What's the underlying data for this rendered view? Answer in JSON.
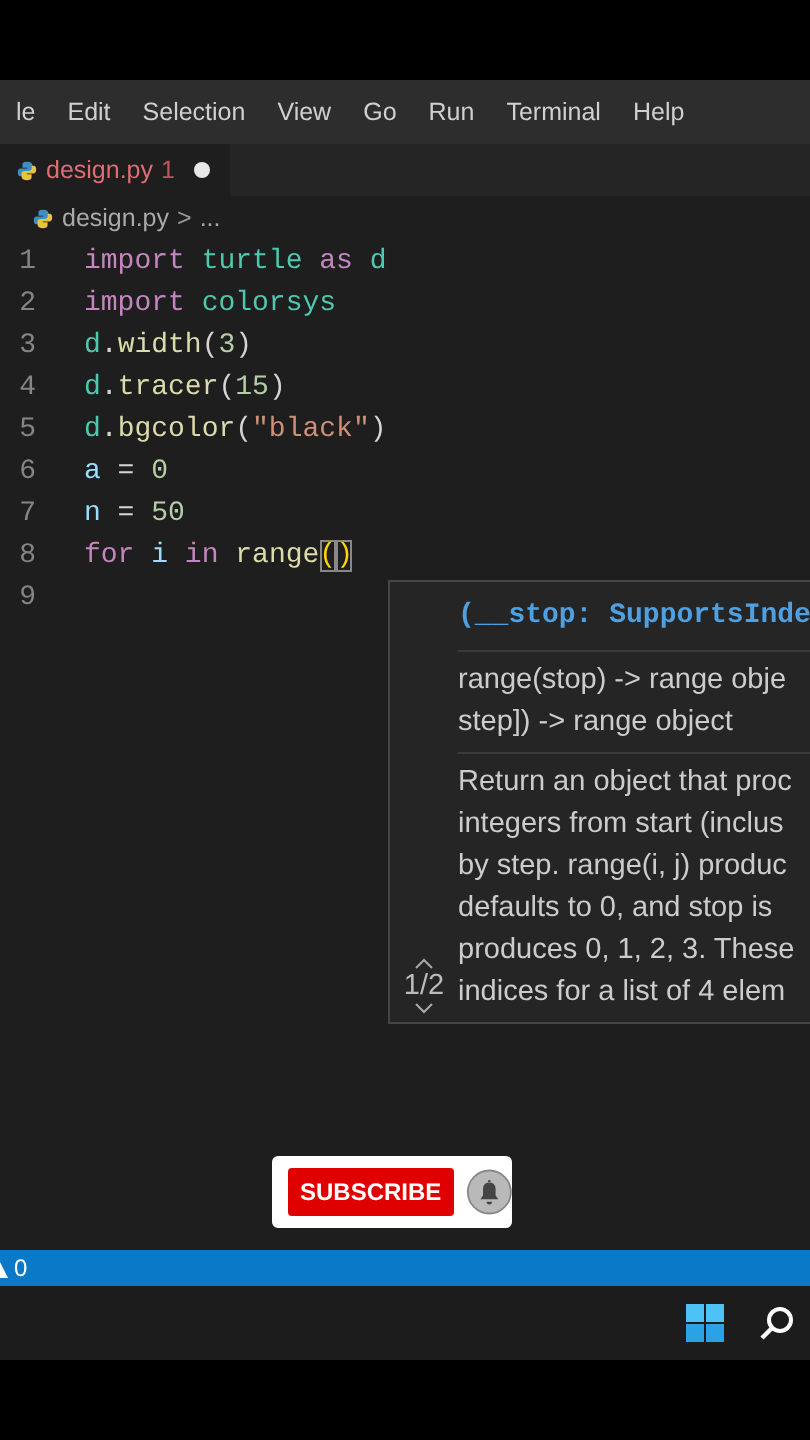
{
  "menu": [
    "le",
    "Edit",
    "Selection",
    "View",
    "Go",
    "Run",
    "Terminal",
    "Help"
  ],
  "tabs": [
    {
      "label": "design.py",
      "badge": "1",
      "modified": true,
      "selected": true
    }
  ],
  "breadcrumb": {
    "file": "design.py",
    "separator": ">",
    "rest": "..."
  },
  "code": {
    "lines": [
      {
        "number": "1",
        "tokens": [
          {
            "text": "import ",
            "kind": "keyword"
          },
          {
            "text": "turtle ",
            "kind": "module"
          },
          {
            "text": "as ",
            "kind": "keyword"
          },
          {
            "text": "d",
            "kind": "module"
          }
        ]
      },
      {
        "number": "2",
        "tokens": [
          {
            "text": "import ",
            "kind": "keyword"
          },
          {
            "text": "colorsys",
            "kind": "module"
          }
        ]
      },
      {
        "number": "3",
        "tokens": [
          {
            "text": "d",
            "kind": "module"
          },
          {
            "text": ".",
            "kind": "plain"
          },
          {
            "text": "width",
            "kind": "function"
          },
          {
            "text": "(",
            "kind": "plain"
          },
          {
            "text": "3",
            "kind": "number"
          },
          {
            "text": ")",
            "kind": "plain"
          }
        ]
      },
      {
        "number": "4",
        "tokens": [
          {
            "text": "d",
            "kind": "module"
          },
          {
            "text": ".",
            "kind": "plain"
          },
          {
            "text": "tracer",
            "kind": "function"
          },
          {
            "text": "(",
            "kind": "plain"
          },
          {
            "text": "15",
            "kind": "number"
          },
          {
            "text": ")",
            "kind": "plain"
          }
        ]
      },
      {
        "number": "5",
        "tokens": [
          {
            "text": "d",
            "kind": "module"
          },
          {
            "text": ".",
            "kind": "plain"
          },
          {
            "text": "bgcolor",
            "kind": "function"
          },
          {
            "text": "(",
            "kind": "plain"
          },
          {
            "text": "\"black\"",
            "kind": "string"
          },
          {
            "text": ")",
            "kind": "plain"
          }
        ]
      },
      {
        "number": "6",
        "tokens": [
          {
            "text": "a",
            "kind": "variable"
          },
          {
            "text": " = ",
            "kind": "plain"
          },
          {
            "text": "0",
            "kind": "number"
          }
        ]
      },
      {
        "number": "7",
        "tokens": [
          {
            "text": "n",
            "kind": "variable"
          },
          {
            "text": " = ",
            "kind": "plain"
          },
          {
            "text": "50",
            "kind": "number"
          }
        ]
      },
      {
        "number": "8",
        "tokens": [
          {
            "text": "for ",
            "kind": "keyword"
          },
          {
            "text": "i ",
            "kind": "variable"
          },
          {
            "text": "in ",
            "kind": "keyword"
          },
          {
            "text": "range",
            "kind": "function"
          },
          {
            "text": "(",
            "kind": "bracket"
          },
          {
            "text": ")",
            "kind": "bracket"
          }
        ]
      },
      {
        "number": "9"
      }
    ]
  },
  "hover": {
    "signature": "(__stop: SupportsInde",
    "summary": [
      "range(stop) -> range obje",
      "step]) -> range object"
    ],
    "doc": [
      "Return an object that proc",
      "integers from start (inclus",
      "by step. range(i, j) produc",
      "defaults to 0, and stop is",
      "produces 0, 1, 2, 3. These",
      "indices for a list of 4 elem"
    ],
    "page": "1/2"
  },
  "overlay": {
    "label": "SUBSCRIBE"
  },
  "status": [
    {
      "kind": "warnings",
      "text": "0"
    }
  ]
}
